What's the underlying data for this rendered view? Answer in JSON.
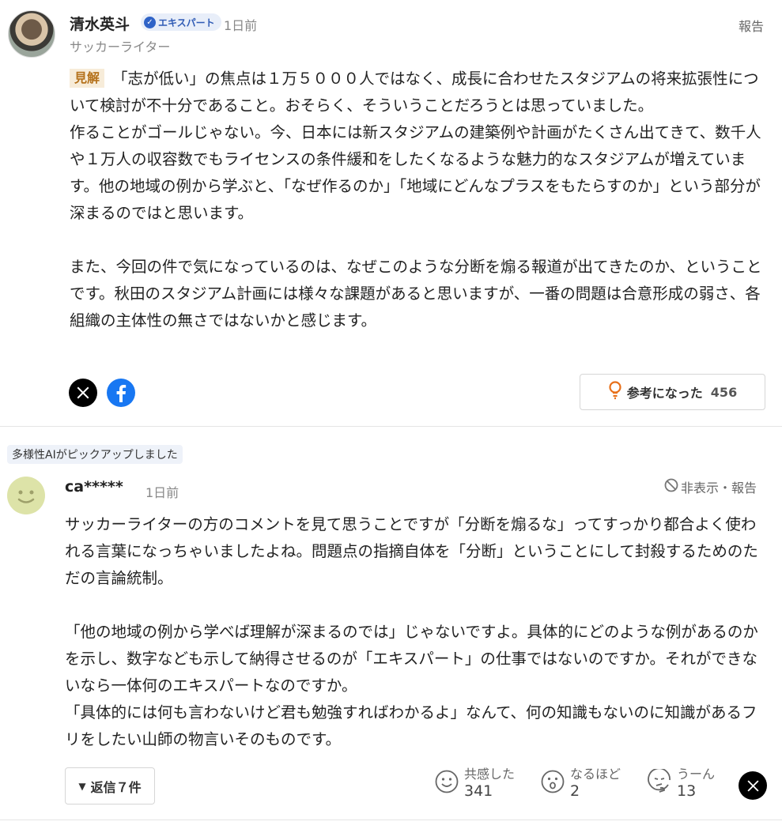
{
  "expert_comment": {
    "name": "清水英斗",
    "badge": "エキスパート",
    "time": "1日前",
    "report": "報告",
    "subtitle": "サッカーライター",
    "tag": "見解",
    "paragraph1": "「志が低い」の焦点は１万５０００人ではなく、成長に合わせたスタジアムの将来拡張性について検討が不十分であること。おそらく、そういうことだろうとは思っていました。",
    "paragraph2": "作ることがゴールじゃない。今、日本には新スタジアムの建築例や計画がたくさん出てきて、数千人や１万人の収容数でもライセンスの条件緩和をしたくなるような魅力的なスタジアムが増えています。他の地域の例から学ぶと、「なぜ作るのか」「地域にどんなプラスをもたらすのか」という部分が深まるのではと思います。",
    "paragraph3": "また、今回の件で気になっているのは、なぜこのような分断を煽る報道が出てきたのか、ということです。秋田のスタジアム計画には様々な課題があると思いますが、一番の問題は合意形成の弱さ、各組織の主体性の無さではないかと感じます。",
    "helpful_label": "参考になった",
    "helpful_count": "456",
    "share_icons": [
      "x-icon",
      "facebook-icon"
    ]
  },
  "ai_pick_label": "多様性AIがピックアップしました",
  "user_comment": {
    "user": "ca*****",
    "time": "1日前",
    "hide_report": "非表示・報告",
    "paragraph1": "サッカーライターの方のコメントを見て思うことですが「分断を煽るな」ってすっかり都合よく使われる言葉になっちゃいましたよね。問題点の指摘自体を「分断」ということにして封殺するためのただの言論統制。",
    "paragraph2": "「他の地域の例から学べば理解が深まるのでは」じゃないですよ。具体的にどのような例があるのかを示し、数字なども示して納得させるのが「エキスパート」の仕事ではないのですか。それができないなら一体何のエキスパートなのですか。",
    "paragraph3": "「具体的には何も言わないけど君も勉強すればわかるよ」なんて、何の知識もないのに知識があるフリをしたい山師の物言いそのものです。",
    "replies_label": "返信７件",
    "reactions": [
      {
        "label": "共感した",
        "count": "341",
        "icon": "smile-icon"
      },
      {
        "label": "なるほど",
        "count": "2",
        "icon": "surprised-icon"
      },
      {
        "label": "うーん",
        "count": "13",
        "icon": "thinking-icon"
      }
    ]
  },
  "colors": {
    "tag_bg": "#f7ecd9",
    "tag_text": "#b5721c",
    "badge_bg": "#e8eef9",
    "facebook": "#1877f2"
  }
}
